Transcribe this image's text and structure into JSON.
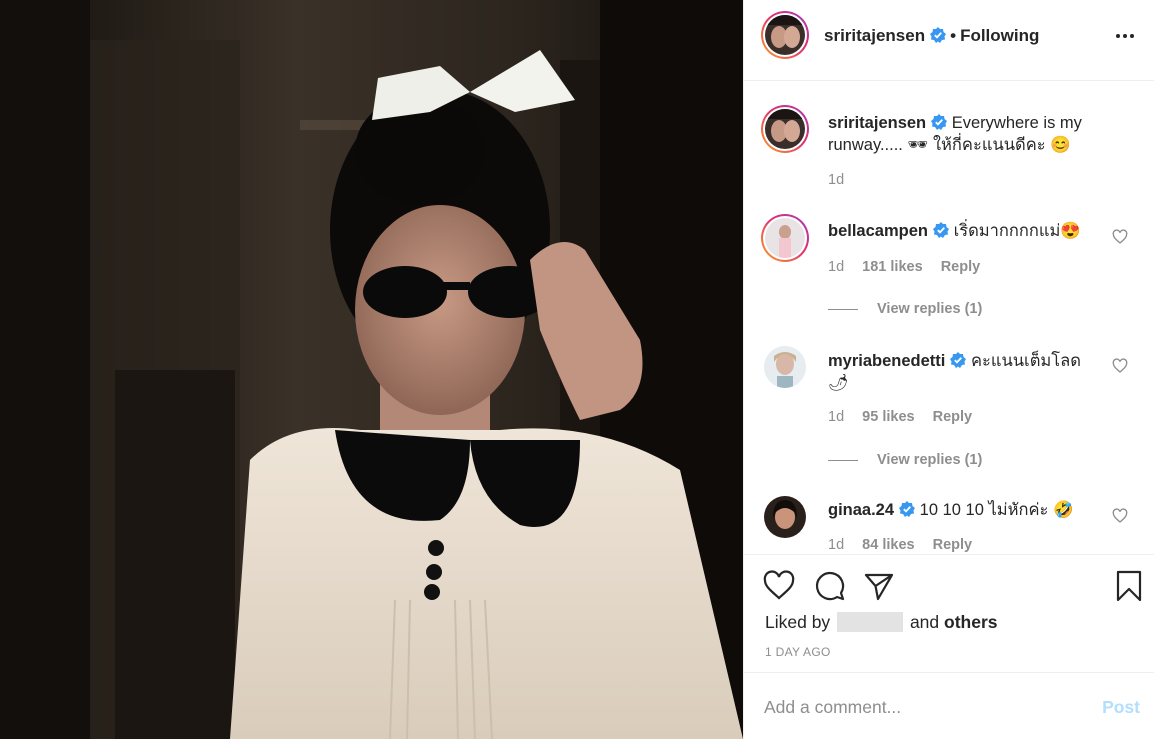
{
  "header": {
    "username": "sriritajensen",
    "separator": "•",
    "follow_status": "Following",
    "more_icon": "more-horizontal-icon"
  },
  "caption": {
    "username": "sriritajensen",
    "text": "Everywhere is my runway..... 🕶 ให้กี่คะแนนดีคะ 😊",
    "age": "1d"
  },
  "comments": [
    {
      "username": "bellacampen",
      "text": "เริ่ดมากกกกแม่😍",
      "age": "1d",
      "likes": "181 likes",
      "reply": "Reply",
      "view_replies": "View replies (1)"
    },
    {
      "username": "myriabenedetti",
      "text": "คะแนนเต็มโลด 🌶",
      "age": "1d",
      "likes": "95 likes",
      "reply": "Reply",
      "view_replies": "View replies (1)"
    },
    {
      "username": "ginaa.24",
      "text": "10 10 10 ไม่หักค่ะ 🤣",
      "age": "1d",
      "likes": "84 likes",
      "reply": "Reply"
    }
  ],
  "actions": {
    "liked_prefix": "Liked by",
    "liked_middle": "and",
    "liked_suffix": "others",
    "timestamp": "1 DAY AGO"
  },
  "comment_box": {
    "placeholder": "Add a comment...",
    "post_label": "Post"
  },
  "colors": {
    "verified": "#3897f0",
    "post_disabled": "#b2dffc",
    "muted": "#8e8e8e"
  }
}
